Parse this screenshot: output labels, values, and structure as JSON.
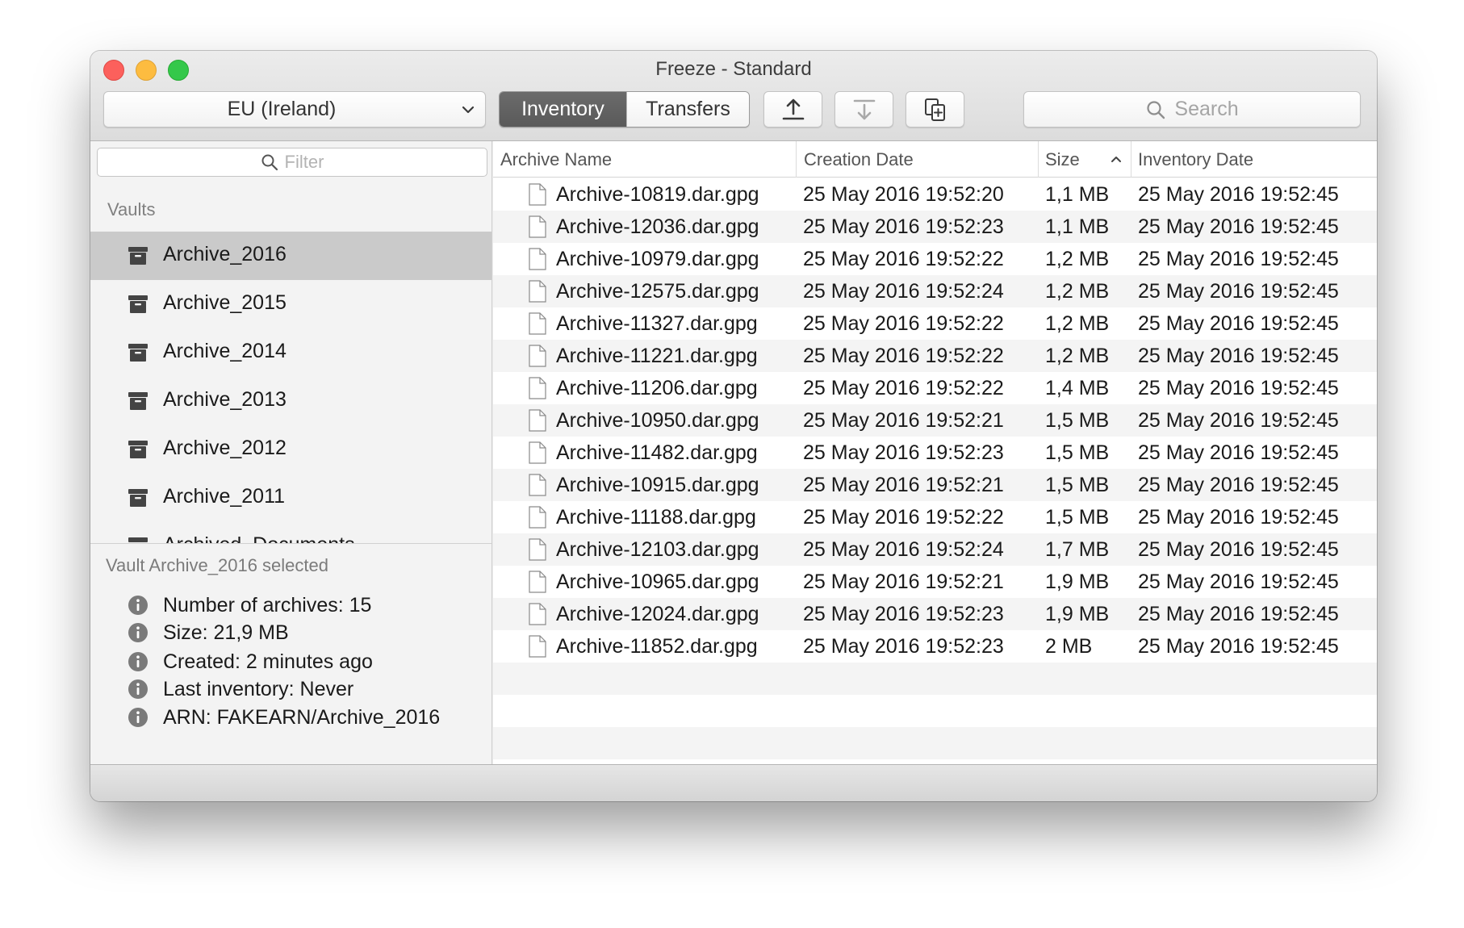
{
  "window": {
    "title": "Freeze - Standard"
  },
  "toolbar": {
    "region_label": "EU (Ireland)",
    "segments": [
      "Inventory",
      "Transfers"
    ],
    "active_segment": "Inventory",
    "search_placeholder": "Search",
    "icons": [
      "upload-icon",
      "download-icon",
      "copy-icon"
    ]
  },
  "sidebar": {
    "filter_placeholder": "Filter",
    "vaults_header": "Vaults",
    "vaults": [
      {
        "label": "Archive_2016",
        "selected": true
      },
      {
        "label": "Archive_2015",
        "selected": false
      },
      {
        "label": "Archive_2014",
        "selected": false
      },
      {
        "label": "Archive_2013",
        "selected": false
      },
      {
        "label": "Archive_2012",
        "selected": false
      },
      {
        "label": "Archive_2011",
        "selected": false
      },
      {
        "label": "Archived_Documents",
        "selected": false
      }
    ],
    "info": {
      "heading": "Vault Archive_2016 selected",
      "items": [
        "Number of archives: 15",
        "Size: 21,9 MB",
        "Created: 2 minutes ago",
        "Last inventory: Never",
        "ARN: FAKEARN/Archive_2016"
      ]
    }
  },
  "table": {
    "columns": [
      "Archive Name",
      "Creation Date",
      "Size",
      "Inventory Date"
    ],
    "sorted_column": "Size",
    "sort_direction": "ascending",
    "rows": [
      {
        "name": "Archive-10819.dar.gpg",
        "created": "25 May 2016 19:52:20",
        "size": "1,1 MB",
        "inventory": "25 May 2016 19:52:45"
      },
      {
        "name": "Archive-12036.dar.gpg",
        "created": "25 May 2016 19:52:23",
        "size": "1,1 MB",
        "inventory": "25 May 2016 19:52:45"
      },
      {
        "name": "Archive-10979.dar.gpg",
        "created": "25 May 2016 19:52:22",
        "size": "1,2 MB",
        "inventory": "25 May 2016 19:52:45"
      },
      {
        "name": "Archive-12575.dar.gpg",
        "created": "25 May 2016 19:52:24",
        "size": "1,2 MB",
        "inventory": "25 May 2016 19:52:45"
      },
      {
        "name": "Archive-11327.dar.gpg",
        "created": "25 May 2016 19:52:22",
        "size": "1,2 MB",
        "inventory": "25 May 2016 19:52:45"
      },
      {
        "name": "Archive-11221.dar.gpg",
        "created": "25 May 2016 19:52:22",
        "size": "1,2 MB",
        "inventory": "25 May 2016 19:52:45"
      },
      {
        "name": "Archive-11206.dar.gpg",
        "created": "25 May 2016 19:52:22",
        "size": "1,4 MB",
        "inventory": "25 May 2016 19:52:45"
      },
      {
        "name": "Archive-10950.dar.gpg",
        "created": "25 May 2016 19:52:21",
        "size": "1,5 MB",
        "inventory": "25 May 2016 19:52:45"
      },
      {
        "name": "Archive-11482.dar.gpg",
        "created": "25 May 2016 19:52:23",
        "size": "1,5 MB",
        "inventory": "25 May 2016 19:52:45"
      },
      {
        "name": "Archive-10915.dar.gpg",
        "created": "25 May 2016 19:52:21",
        "size": "1,5 MB",
        "inventory": "25 May 2016 19:52:45"
      },
      {
        "name": "Archive-11188.dar.gpg",
        "created": "25 May 2016 19:52:22",
        "size": "1,5 MB",
        "inventory": "25 May 2016 19:52:45"
      },
      {
        "name": "Archive-12103.dar.gpg",
        "created": "25 May 2016 19:52:24",
        "size": "1,7 MB",
        "inventory": "25 May 2016 19:52:45"
      },
      {
        "name": "Archive-10965.dar.gpg",
        "created": "25 May 2016 19:52:21",
        "size": "1,9 MB",
        "inventory": "25 May 2016 19:52:45"
      },
      {
        "name": "Archive-12024.dar.gpg",
        "created": "25 May 2016 19:52:23",
        "size": "1,9 MB",
        "inventory": "25 May 2016 19:52:45"
      },
      {
        "name": "Archive-11852.dar.gpg",
        "created": "25 May 2016 19:52:23",
        "size": "2 MB",
        "inventory": "25 May 2016 19:52:45"
      }
    ]
  }
}
